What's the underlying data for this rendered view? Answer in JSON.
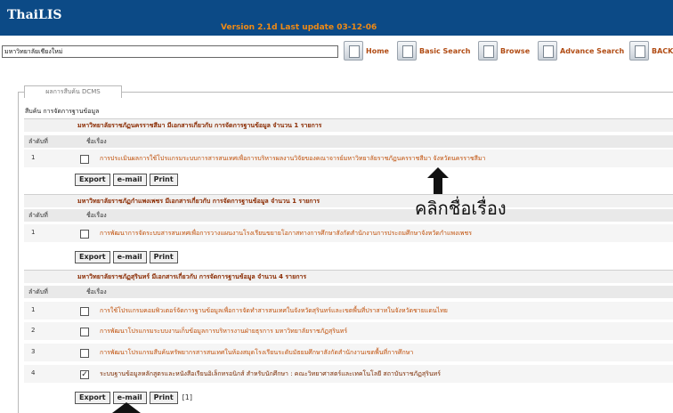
{
  "header": {
    "brand": "ThaiLIS",
    "version": "Version 2.1d Last update 03-12-06"
  },
  "toolbar": {
    "library_name": "มหาวิทยาลัยเชียงใหม่",
    "home_label": "Home",
    "basic_search_label": "Basic Search",
    "browse_label": "Browse",
    "advance_search_label": "Advance Search",
    "back_label": "BACK"
  },
  "tab": {
    "label": "ผลการสืบค้น DCMS"
  },
  "breadcrumb": "สืบค้น การจัดการฐานข้อมูล",
  "columns": {
    "no": "ลำดับที่",
    "title": "ชื่อเรื่อง"
  },
  "buttons": {
    "export": "Export",
    "email": "e-mail",
    "print": "Print"
  },
  "sections": [
    {
      "heading": "มหาวิทยาลัยราชภัฏนครราชสีมา มีเอกสารเกี่ยวกับ การจัดการฐานข้อมูล จำนวน 1 รายการ",
      "rows": [
        {
          "no": "1",
          "checked": false,
          "title": "การประเมินผลการใช้โปรแกรมระบบการสารสนเทศเพื่อการบริหารผลงานวิจัยของคณาจารย์มหาวิทยาลัยราชภัฏนครราชสีมา จังหวัดนครราชสีมา"
        }
      ]
    },
    {
      "heading": "มหาวิทยาลัยราชภัฏกำแพงเพชร มีเอกสารเกี่ยวกับ การจัดการฐานข้อมูล จำนวน 1 รายการ",
      "rows": [
        {
          "no": "1",
          "checked": false,
          "title": "การพัฒนาการจัดระบบสารสนเทศเพื่อการวางแผนงานโรงเรียนขยายโอกาสทางการศึกษาสังกัดสำนักงานการประถมศึกษาจังหวัดกำแพงเพชร"
        }
      ]
    },
    {
      "heading": "มหาวิทยาลัยราชภัฏสุรินทร์ มีเอกสารเกี่ยวกับ การจัดการฐานข้อมูล จำนวน 4 รายการ",
      "rows": [
        {
          "no": "1",
          "checked": false,
          "title": "การใช้โปรแกรมคอมพิวเตอร์จัดการฐานข้อมูลเพื่อการจัดทำสารสนเทศในจังหวัดสุรินทร์และเขตพื้นที่ปราสาทในจังหวัดชายแดนไทย"
        },
        {
          "no": "2",
          "checked": false,
          "title": "การพัฒนาโปรแกรมระบบงานเก็บข้อมูลการบริหารงานฝ่ายธุรการ มหาวิทยาลัยราชภัฏสุรินทร์"
        },
        {
          "no": "3",
          "checked": false,
          "title": "การพัฒนาโปรแกรมสืบค้นทรัพยากรสารสนเทศในห้องสมุดโรงเรียนระดับมัธยมศึกษาสังกัดสำนักงานเขตพื้นที่การศึกษา"
        },
        {
          "no": "4",
          "checked": true,
          "title": "ระบบฐานข้อมูลหลักสูตรและหนังสือเรียนอิเล็กทรอนิกส์ สำหรับนักศึกษา : คณะวิทยาศาสตร์และเทคโนโลยี สถาบันราชภัฏสุรินทร์"
        }
      ]
    }
  ],
  "selection_count": "[1]",
  "annotation": "คลิกชื่อเรื่อง",
  "colors": {
    "banner": "#0c4a86",
    "title_link": "#c0500a",
    "version": "#f08a14"
  }
}
